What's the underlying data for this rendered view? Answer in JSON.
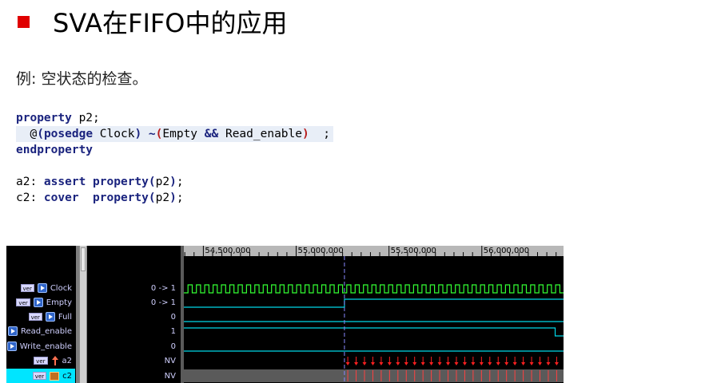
{
  "slide": {
    "title": "SVA在FIFO中的应用",
    "example": "例: 空状态的检查。"
  },
  "code": {
    "lines": [
      [
        {
          "t": "property",
          "c": "kw"
        },
        {
          "t": " p2;",
          "c": ""
        }
      ],
      [
        {
          "t": "  @",
          "c": ""
        },
        {
          "t": "(",
          "c": "op"
        },
        {
          "t": "posedge",
          "c": "kw"
        },
        {
          "t": " Clock",
          "c": ""
        },
        {
          "t": ")",
          "c": "op"
        },
        {
          "t": " ",
          "c": ""
        },
        {
          "t": "~",
          "c": "op"
        },
        {
          "t": "(",
          "c": "paren"
        },
        {
          "t": "Empty ",
          "c": ""
        },
        {
          "t": "&&",
          "c": "op"
        },
        {
          "t": " Read_enable",
          "c": ""
        },
        {
          "t": ")",
          "c": "paren"
        },
        {
          "t": "  ;",
          "c": ""
        }
      ],
      [
        {
          "t": "endproperty",
          "c": "kw"
        }
      ],
      [],
      [
        {
          "t": "a2: ",
          "c": ""
        },
        {
          "t": "assert",
          "c": "kw"
        },
        {
          "t": " ",
          "c": ""
        },
        {
          "t": "property",
          "c": "kw"
        },
        {
          "t": "(",
          "c": "op"
        },
        {
          "t": "p2",
          "c": ""
        },
        {
          "t": ")",
          "c": "op"
        },
        {
          "t": ";",
          "c": ""
        }
      ],
      [
        {
          "t": "c2: ",
          "c": ""
        },
        {
          "t": "cover",
          "c": "kw"
        },
        {
          "t": "  ",
          "c": ""
        },
        {
          "t": "property",
          "c": "kw"
        },
        {
          "t": "(",
          "c": "op"
        },
        {
          "t": "p2",
          "c": ""
        },
        {
          "t": ")",
          "c": "op"
        },
        {
          "t": ";",
          "c": ""
        }
      ]
    ]
  },
  "waveform": {
    "ruler_labels": [
      "54,500,000",
      "55,000,000",
      "55,500,000",
      "56,000,000"
    ],
    "ruler_times": [
      54500000,
      55000000,
      55500000,
      56000000
    ],
    "view_start": 54395000,
    "view_end": 56440000,
    "cursor_time": 55260000,
    "clock_period": 45000,
    "signals": [
      {
        "name": "Clock",
        "tag": "ver",
        "icon": "signal-icon",
        "value": "0 -> 1",
        "kind": "clock"
      },
      {
        "name": "Empty",
        "tag": "ver",
        "icon": "signal-icon",
        "value": "0 -> 1",
        "kind": "step",
        "from": 0,
        "to": 1,
        "at": 55260000
      },
      {
        "name": "Full",
        "tag": "ver",
        "icon": "signal-icon",
        "value": "0",
        "kind": "const",
        "level": 0
      },
      {
        "name": "Read_enable",
        "tag": "",
        "icon": "signal-icon",
        "value": "1",
        "kind": "step",
        "from": 1,
        "to": 0,
        "at": 56395000
      },
      {
        "name": "Write_enable",
        "tag": "",
        "icon": "signal-icon",
        "value": "0",
        "kind": "const",
        "level": 0
      },
      {
        "name": "a2",
        "tag": "ver",
        "icon": "arrow-up-icon",
        "value": "NV",
        "kind": "assert"
      },
      {
        "name": "c2",
        "tag": "ver",
        "icon": "cover-icon",
        "value": "NV",
        "kind": "cover",
        "selected": true
      }
    ],
    "colors": {
      "clock": "#33ff33",
      "data": "#00d8e8",
      "fail": "#ff2020",
      "cursor": "#8888ff",
      "ruler_bg": "#b8b8b8",
      "selected_row": "#00e5ff"
    }
  }
}
